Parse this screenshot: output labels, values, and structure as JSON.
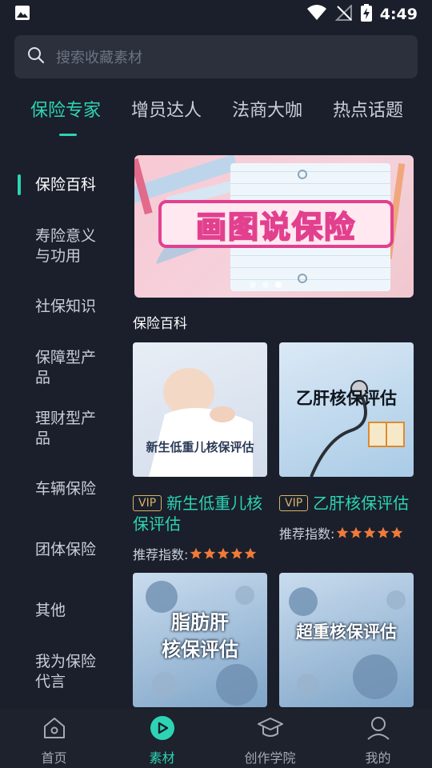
{
  "status_bar": {
    "time": "4:49"
  },
  "search": {
    "placeholder": "搜索收藏素材"
  },
  "top_tabs": [
    {
      "label": "保险专家",
      "active": true
    },
    {
      "label": "增员达人",
      "active": false
    },
    {
      "label": "法商大咖",
      "active": false
    },
    {
      "label": "热点话题",
      "active": false
    }
  ],
  "side_nav": [
    {
      "label": "保险百科",
      "active": true
    },
    {
      "label": "寿险意义与功用",
      "active": false
    },
    {
      "label": "社保知识",
      "active": false
    },
    {
      "label": "保障型产品",
      "active": false
    },
    {
      "label": "理财型产品",
      "active": false
    },
    {
      "label": "车辆保险",
      "active": false
    },
    {
      "label": "团体保险",
      "active": false
    },
    {
      "label": "其他",
      "active": false
    },
    {
      "label": "我为保险代言",
      "active": false
    }
  ],
  "banner": {
    "title": "画图说保险",
    "slide_count": 3,
    "active_slide": 3
  },
  "section": {
    "title": "保险百科"
  },
  "cards": [
    {
      "vip": "VIP",
      "title": "新生低重儿核保评估",
      "thumb_caption": "新生低重儿核保评估",
      "rating_label": "推荐指数:",
      "stars": 5
    },
    {
      "vip": "VIP",
      "title": "乙肝核保评估",
      "thumb_caption": "乙肝核保评估",
      "rating_label": "推荐指数:",
      "stars": 5
    },
    {
      "thumb_caption_line1": "脂肪肝",
      "thumb_caption_line2": "核保评估"
    },
    {
      "thumb_caption": "超重核保评估"
    }
  ],
  "bottom_nav": [
    {
      "label": "首页",
      "icon": "home-icon",
      "active": false
    },
    {
      "label": "素材",
      "icon": "play-icon",
      "active": true
    },
    {
      "label": "创作学院",
      "icon": "graduation-cap-icon",
      "active": false
    },
    {
      "label": "我的",
      "icon": "user-icon",
      "active": false
    }
  ],
  "colors": {
    "accent": "#2dd4b3",
    "background": "#1a1f2b",
    "vip": "#d7b36a",
    "star": "#f07a3a"
  }
}
